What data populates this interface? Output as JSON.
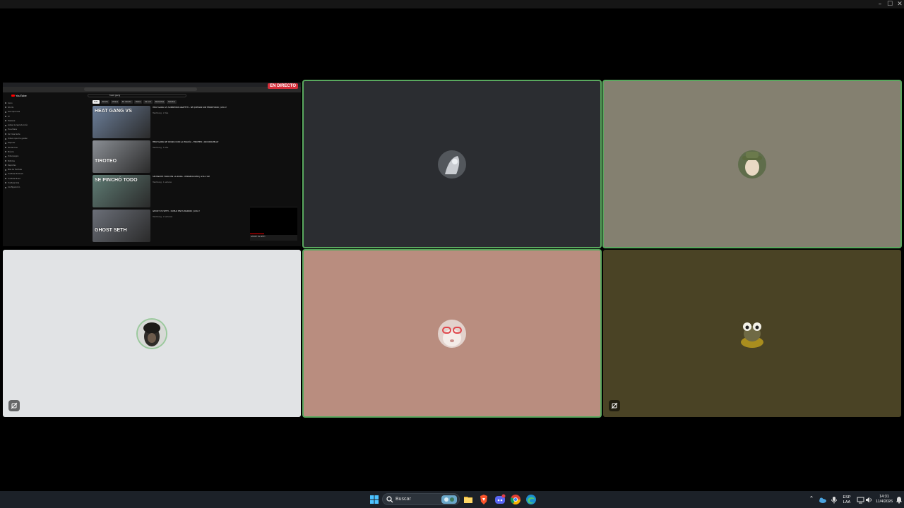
{
  "window": {
    "controls": [
      "–",
      "☐",
      "✕"
    ]
  },
  "screen_share": {
    "live_badge": "EN DIRECTO",
    "youtube": {
      "logo": "YouTube",
      "search_value": "heat gang",
      "sidebar": [
        "Inicio",
        "Shorts",
        "Suscripciones",
        "Tú",
        "Historial",
        "Listas de reproducción",
        "Tus vídeos",
        "Ver más tarde",
        "Videos que me gustan",
        "Explorar",
        "Tendencias",
        "Música",
        "Videojuegos",
        "Noticias",
        "Deportes",
        "Más de YouTube",
        "YouTube Premium",
        "YouTube Music",
        "YouTube Kids",
        "Configuración"
      ],
      "chips": [
        "Todo",
        "Shorts",
        "Videos",
        "En directo",
        "Vistos",
        "Sin ver",
        "Recientes",
        "Subidos"
      ],
      "videos": [
        {
          "title": "HEAT GANG VS SUPREMOS GRAFFITI - SE QUEDAN SIN TERRITORIO | GTA V",
          "meta": "Heat Gang · 2 días",
          "thumb_text": "HEAT GANG VS",
          "thumb_color": "#6c7f9a"
        },
        {
          "title": "HEAT GANG SE CRUZA CON LA POLICÍA - TIROTEO | GTA ROLEPLAY",
          "meta": "Heat Gang · 5 días",
          "thumb_text": "TIROTEO",
          "thumb_color": "#8a8e94"
        },
        {
          "title": "SE PINCHÓ TODO EN LA ZONA - PERSECUCIÓN | GTA V RP",
          "meta": "Heat Gang · 1 semana",
          "thumb_text": "SE PINCHÓ TODO",
          "thumb_color": "#5f7c74"
        },
        {
          "title": "GHOST VS SETH - DUELO EN EL BARRIO | GTA V",
          "meta": "Heat Gang · 2 semanas",
          "thumb_text": "GHOST SETH",
          "thumb_color": "#6b6f78"
        }
      ],
      "mini_player_label": "GHOST VS SETH"
    }
  },
  "tiles": [
    {
      "id": "user-2",
      "bg": "#2b2d31",
      "speaking": true,
      "muted": false,
      "avatar_color": "#c9ccd1"
    },
    {
      "id": "user-3",
      "bg": "#848070",
      "speaking": true,
      "muted": false,
      "avatar_color": "#9b9c86"
    },
    {
      "id": "user-4",
      "bg": "#e1e3e5",
      "speaking": false,
      "muted": true,
      "avatar_color": "#3b3a36"
    },
    {
      "id": "user-5",
      "bg": "#b98d7f",
      "speaking": true,
      "muted": false,
      "avatar_color": "#d9c8c2"
    },
    {
      "id": "user-6",
      "bg": "#4a4325",
      "speaking": false,
      "muted": true,
      "avatar_color": "#a79a3a"
    }
  ],
  "taskbar": {
    "search_placeholder": "Buscar",
    "lang_top": "ESP",
    "lang_bottom": "LAA",
    "time": "14:31",
    "date": "11/4/2026"
  }
}
